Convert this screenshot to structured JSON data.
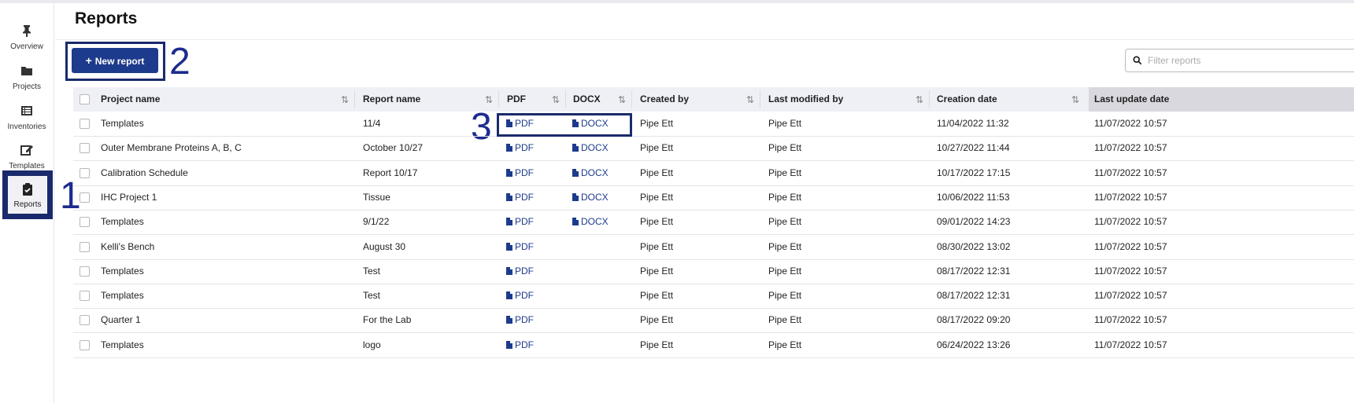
{
  "page": {
    "title": "Reports"
  },
  "sidebar": {
    "items": [
      {
        "label": "Overview",
        "icon": "pin-icon",
        "active": false
      },
      {
        "label": "Projects",
        "icon": "folder-icon",
        "active": false
      },
      {
        "label": "Inventories",
        "icon": "list-icon",
        "active": false
      },
      {
        "label": "Templates",
        "icon": "edit-icon",
        "active": false
      },
      {
        "label": "Reports",
        "icon": "clipboard-check-icon",
        "active": true
      }
    ]
  },
  "toolbar": {
    "new_report_label": "New report",
    "filter_placeholder": "Filter reports"
  },
  "annotations": {
    "a1": "1",
    "a2": "2",
    "a3": "3"
  },
  "table": {
    "headers": [
      "Project name",
      "Report name",
      "PDF",
      "DOCX",
      "Created by",
      "Last modified by",
      "Creation date",
      "Last update date"
    ],
    "rows": [
      {
        "project": "Templates",
        "report": "11/4",
        "pdf": "PDF",
        "docx": "DOCX",
        "created_by": "Pipe Ett",
        "modified_by": "Pipe Ett",
        "created": "11/04/2022 11:32",
        "updated": "11/07/2022 10:57"
      },
      {
        "project": "Outer Membrane Proteins A, B, C",
        "report": "October 10/27",
        "pdf": "PDF",
        "docx": "DOCX",
        "created_by": "Pipe Ett",
        "modified_by": "Pipe Ett",
        "created": "10/27/2022 11:44",
        "updated": "11/07/2022 10:57"
      },
      {
        "project": "Calibration Schedule",
        "report": "Report 10/17",
        "pdf": "PDF",
        "docx": "DOCX",
        "created_by": "Pipe Ett",
        "modified_by": "Pipe Ett",
        "created": "10/17/2022 17:15",
        "updated": "11/07/2022 10:57"
      },
      {
        "project": "IHC Project 1",
        "report": "Tissue",
        "pdf": "PDF",
        "docx": "DOCX",
        "created_by": "Pipe Ett",
        "modified_by": "Pipe Ett",
        "created": "10/06/2022 11:53",
        "updated": "11/07/2022 10:57"
      },
      {
        "project": "Templates",
        "report": "9/1/22",
        "pdf": "PDF",
        "docx": "DOCX",
        "created_by": "Pipe Ett",
        "modified_by": "Pipe Ett",
        "created": "09/01/2022 14:23",
        "updated": "11/07/2022 10:57"
      },
      {
        "project": "Kelli's Bench",
        "report": "August 30",
        "pdf": "PDF",
        "docx": "",
        "created_by": "Pipe Ett",
        "modified_by": "Pipe Ett",
        "created": "08/30/2022 13:02",
        "updated": "11/07/2022 10:57"
      },
      {
        "project": "Templates",
        "report": "Test",
        "pdf": "PDF",
        "docx": "",
        "created_by": "Pipe Ett",
        "modified_by": "Pipe Ett",
        "created": "08/17/2022 12:31",
        "updated": "11/07/2022 10:57"
      },
      {
        "project": "Templates",
        "report": "Test",
        "pdf": "PDF",
        "docx": "",
        "created_by": "Pipe Ett",
        "modified_by": "Pipe Ett",
        "created": "08/17/2022 12:31",
        "updated": "11/07/2022 10:57"
      },
      {
        "project": "Quarter 1",
        "report": "For the Lab",
        "pdf": "PDF",
        "docx": "",
        "created_by": "Pipe Ett",
        "modified_by": "Pipe Ett",
        "created": "08/17/2022 09:20",
        "updated": "11/07/2022 10:57"
      },
      {
        "project": "Templates",
        "report": "logo",
        "pdf": "PDF",
        "docx": "",
        "created_by": "Pipe Ett",
        "modified_by": "Pipe Ett",
        "created": "06/24/2022 13:26",
        "updated": "11/07/2022 10:57"
      }
    ]
  },
  "colors": {
    "accent": "#1d3b8c",
    "annotation": "#1c2b8f",
    "frame": "#1a2a6c"
  }
}
